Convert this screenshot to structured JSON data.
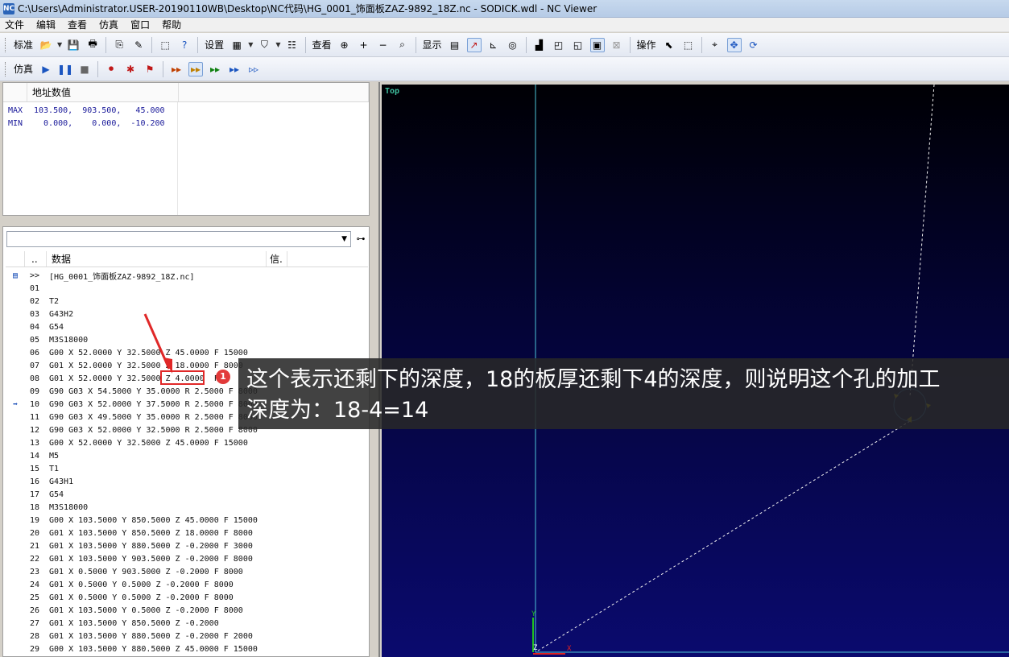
{
  "window": {
    "title": "C:\\Users\\Administrator.USER-20190110WB\\Desktop\\NC代码\\HG_0001_饰面板ZAZ-9892_18Z.nc - SODICK.wdl - NC Viewer",
    "app_icon": "NC"
  },
  "menu": [
    "文件",
    "编辑",
    "查看",
    "仿真",
    "窗口",
    "帮助"
  ],
  "toolbar1": {
    "standard": "标准",
    "settings": "设置",
    "view": "查看",
    "display": "显示",
    "operate": "操作"
  },
  "toolbar2": {
    "simulate": "仿真"
  },
  "address_panel": {
    "header": "地址数值",
    "max_label": "MAX",
    "max_values": "103.500,  903.500,   45.000",
    "min_label": "MIN",
    "min_values": "  0.000,    0.000,  -10.200"
  },
  "code_panel": {
    "col_dots": "..",
    "col_data": "数据",
    "col_info": "信.",
    "find_icon": "binoculars-icon",
    "rows": [
      {
        "marker": ">>",
        "ln": "",
        "code": "[HG_0001_饰面板ZAZ-9892_18Z.nc]"
      },
      {
        "marker": "",
        "ln": "01",
        "code": ""
      },
      {
        "marker": "",
        "ln": "02",
        "code": "T2"
      },
      {
        "marker": "",
        "ln": "03",
        "code": "G43H2"
      },
      {
        "marker": "",
        "ln": "04",
        "code": "G54"
      },
      {
        "marker": "",
        "ln": "05",
        "code": "M3S18000"
      },
      {
        "marker": "",
        "ln": "06",
        "code": "G00 X 52.0000 Y 32.5000 Z 45.0000 F 15000"
      },
      {
        "marker": "",
        "ln": "07",
        "code": "G01 X 52.0000 Y 32.5000 Z 18.0000 F 8000"
      },
      {
        "marker": "",
        "ln": "08",
        "code": "G01 X 52.0000 Y 32.5000 Z 4.0000  F"
      },
      {
        "marker": "",
        "ln": "09",
        "code": "G90 G03 X 54.5000 Y 35.0000 R 2.5000 F 8000"
      },
      {
        "marker": "arrow",
        "ln": "10",
        "code": "G90 G03 X 52.0000 Y 37.5000 R 2.5000 F 8000"
      },
      {
        "marker": "",
        "ln": "11",
        "code": "G90 G03 X 49.5000 Y 35.0000 R 2.5000 F 8000"
      },
      {
        "marker": "",
        "ln": "12",
        "code": "G90 G03 X 52.0000 Y 32.5000 R 2.5000 F 8000"
      },
      {
        "marker": "",
        "ln": "13",
        "code": "G00 X 52.0000 Y 32.5000 Z 45.0000 F 15000"
      },
      {
        "marker": "",
        "ln": "14",
        "code": "M5"
      },
      {
        "marker": "",
        "ln": "15",
        "code": "T1"
      },
      {
        "marker": "",
        "ln": "16",
        "code": "G43H1"
      },
      {
        "marker": "",
        "ln": "17",
        "code": "G54"
      },
      {
        "marker": "",
        "ln": "18",
        "code": "M3S18000"
      },
      {
        "marker": "",
        "ln": "19",
        "code": "G00 X 103.5000 Y 850.5000 Z 45.0000 F 15000"
      },
      {
        "marker": "",
        "ln": "20",
        "code": "G01 X 103.5000 Y 850.5000 Z 18.0000 F 8000"
      },
      {
        "marker": "",
        "ln": "21",
        "code": "G01 X 103.5000 Y 880.5000 Z -0.2000 F 3000"
      },
      {
        "marker": "",
        "ln": "22",
        "code": "G01 X 103.5000 Y 903.5000 Z -0.2000 F 8000"
      },
      {
        "marker": "",
        "ln": "23",
        "code": "G01 X 0.5000 Y 903.5000 Z -0.2000 F 8000"
      },
      {
        "marker": "",
        "ln": "24",
        "code": "G01 X 0.5000 Y 0.5000 Z -0.2000 F 8000"
      },
      {
        "marker": "",
        "ln": "25",
        "code": "G01 X 0.5000 Y 0.5000 Z -0.2000 F 8000"
      },
      {
        "marker": "",
        "ln": "26",
        "code": "G01 X 103.5000 Y 0.5000 Z -0.2000 F 8000"
      },
      {
        "marker": "",
        "ln": "27",
        "code": "G01 X 103.5000 Y 850.5000 Z -0.2000"
      },
      {
        "marker": "",
        "ln": "28",
        "code": "G01 X 103.5000 Y 880.5000 Z -0.2000 F 2000"
      },
      {
        "marker": "",
        "ln": "29",
        "code": "G00 X 103.5000 Y 880.5000 Z 45.0000 F 15000"
      }
    ]
  },
  "viewport": {
    "label": "Top",
    "axis_y": "Y",
    "axis_x": "X",
    "axis_z": "Z"
  },
  "annotation": {
    "badge": "1",
    "text_line1": "这个表示还剩下的深度，18的板厚还剩下4的深度，则说明这个孔的加工",
    "text_line2": "深度为：18-4=14"
  },
  "colors": {
    "accent": "#e02828",
    "canvas_top": "#000004",
    "canvas_bottom": "#0a0a6e",
    "path": "#f0f0f0",
    "axis": "#4dc4d8"
  }
}
